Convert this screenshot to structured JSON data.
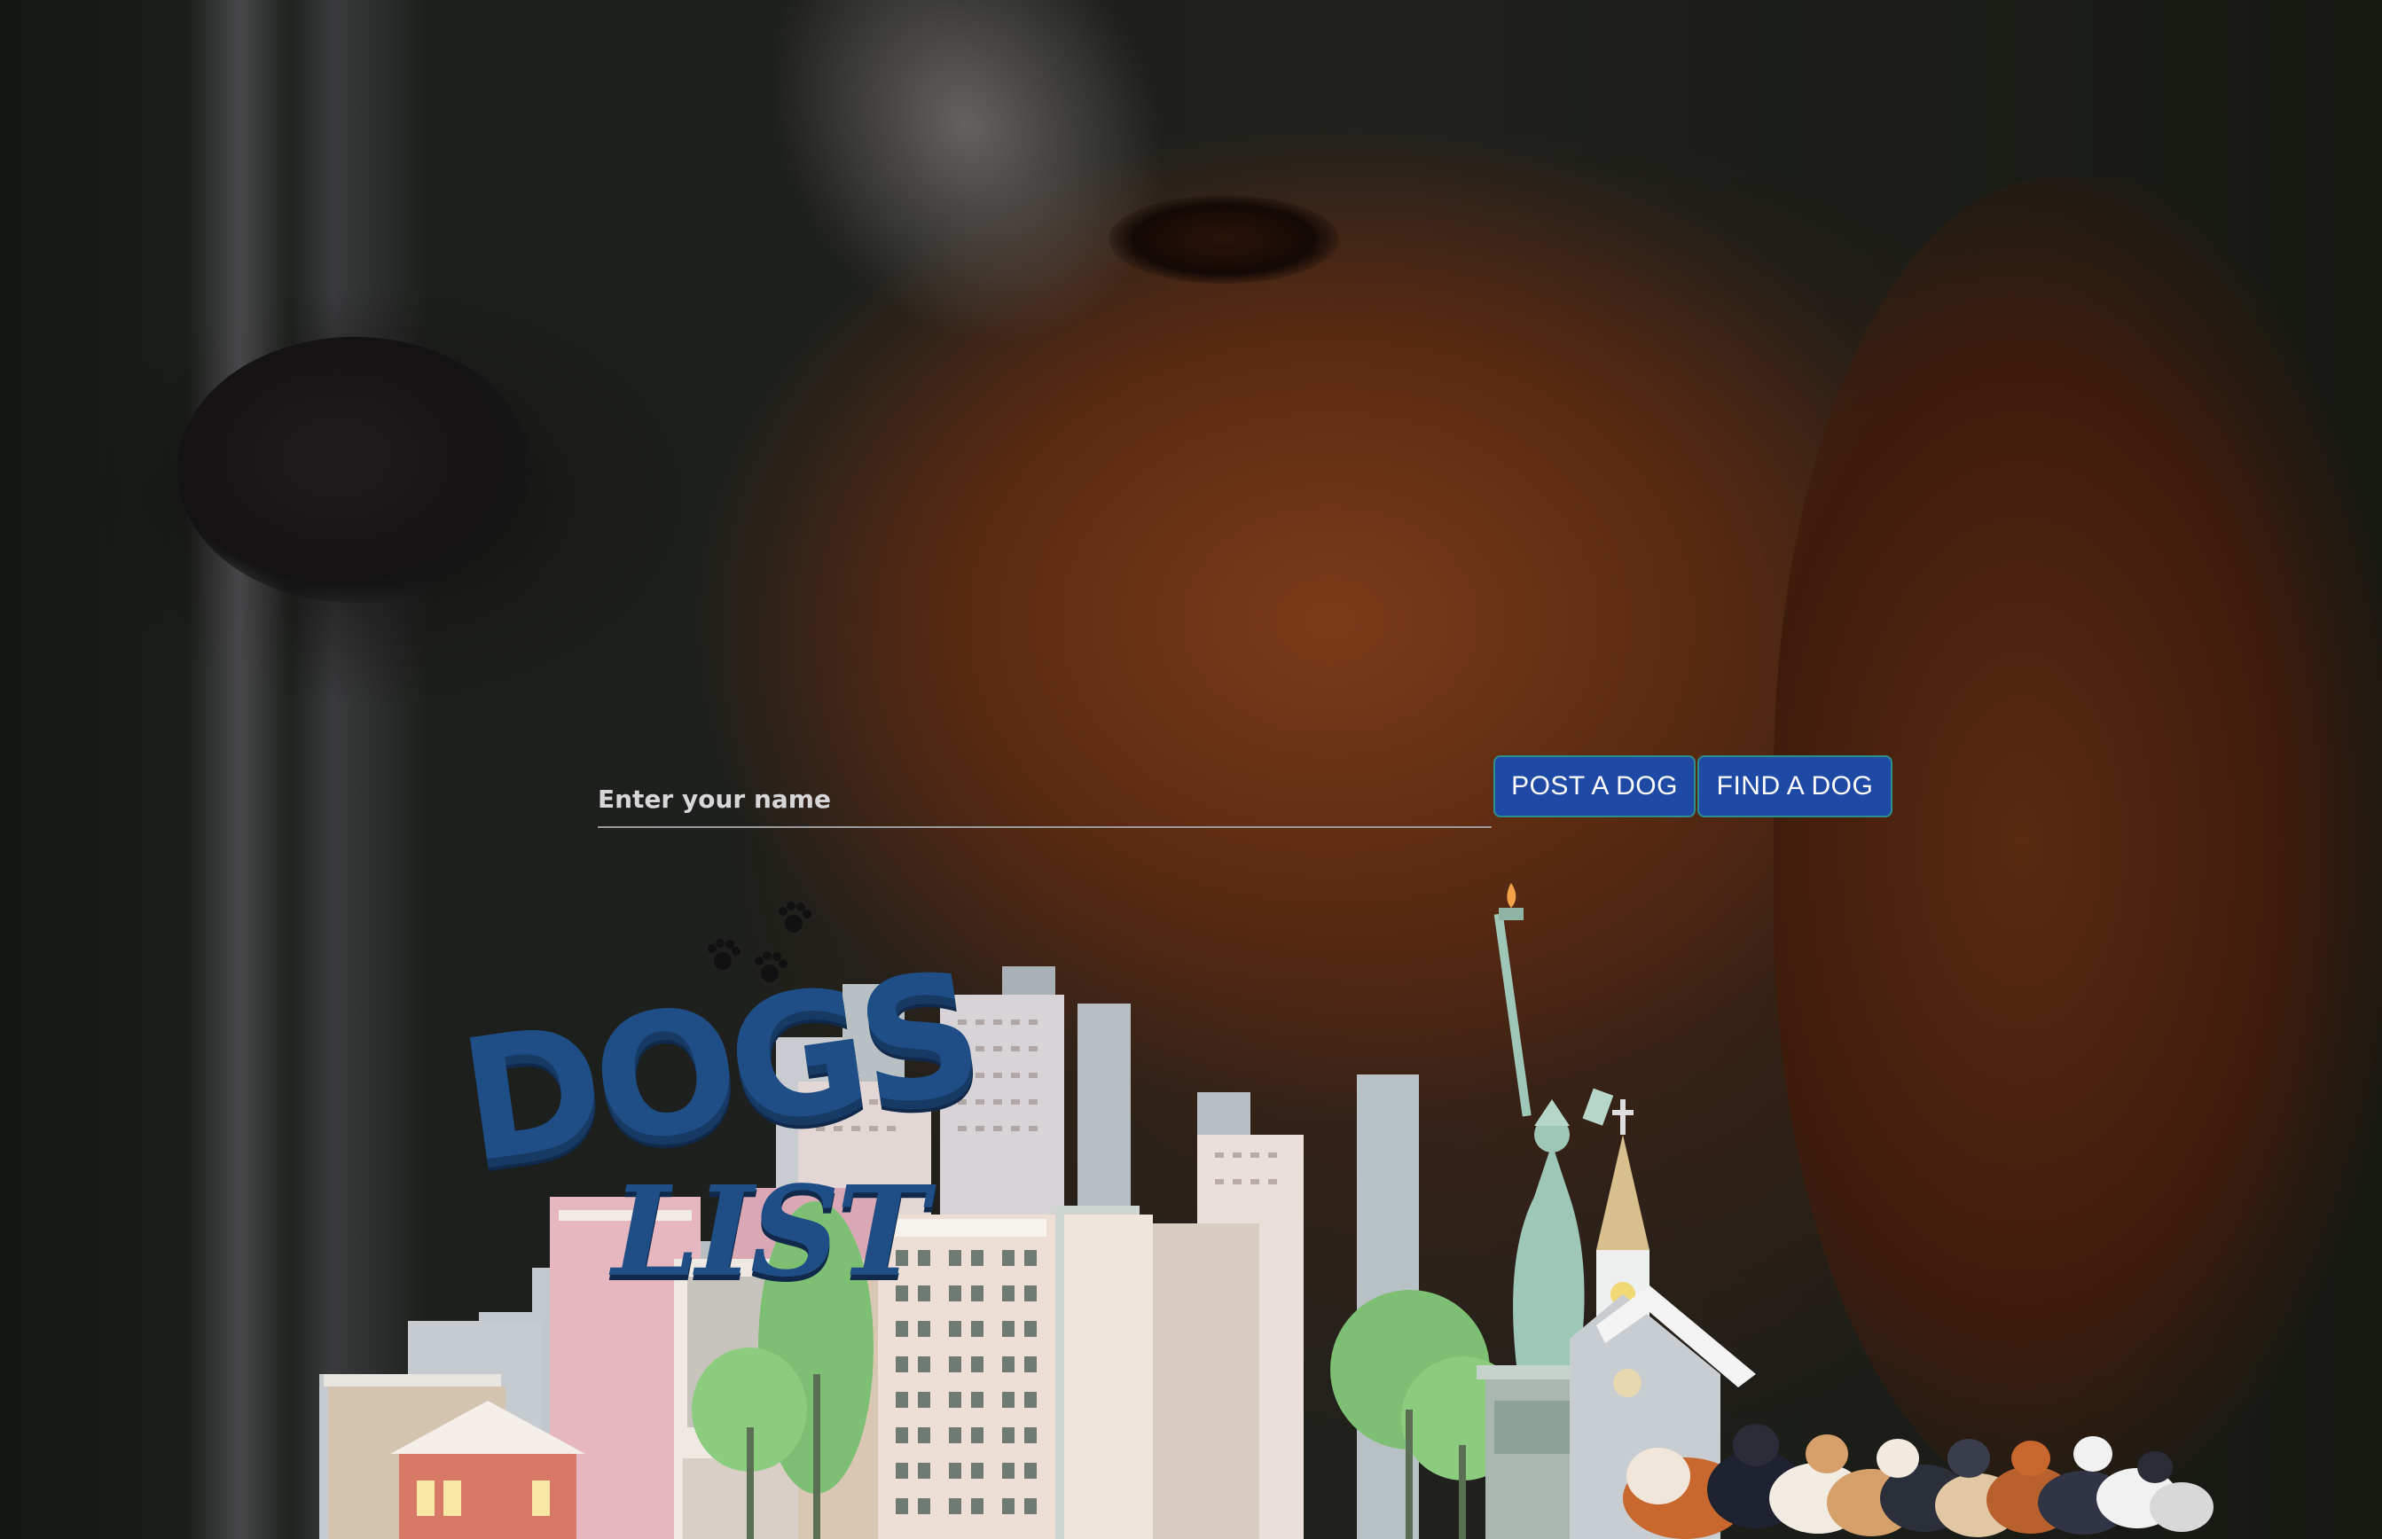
{
  "form": {
    "name_placeholder": "Enter your name",
    "post_button": "POST A DOG",
    "find_button": "FIND A DOG"
  },
  "logo": {
    "line1": "DOGS",
    "line2": "LIST"
  },
  "colors": {
    "button_bg": "#1e4aa5",
    "button_border": "#2f8e8a",
    "logo_blue": "#1f4e86",
    "input_underline": "#9a9a9a"
  }
}
